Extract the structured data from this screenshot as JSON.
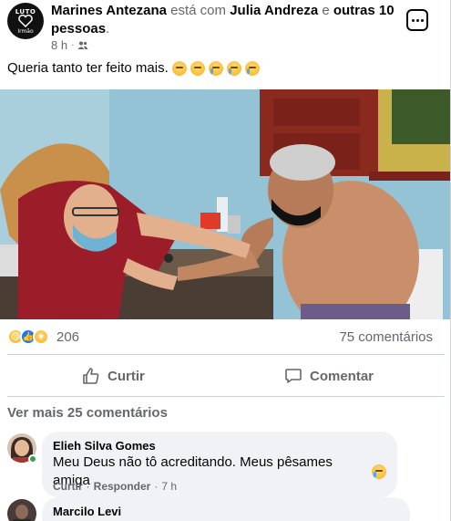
{
  "post": {
    "avatar": {
      "line1": "LUTO",
      "line2": "Irmão"
    },
    "author": "Marines Antezana",
    "with_text": "está com",
    "tagged": "Julia Andreza",
    "and_text": "e",
    "others": "outras 10 pessoas",
    "period": ".",
    "time": "8 h",
    "separator": "·",
    "audience_icon": "friends-icon",
    "text": "Queria tanto ter feito mais.",
    "emojis": [
      "sad",
      "sad",
      "crying",
      "crying",
      "crying"
    ]
  },
  "stats": {
    "reaction_icons": [
      "sad",
      "like",
      "care"
    ],
    "reaction_count": "206",
    "comments": "75 comentários"
  },
  "actions": {
    "like_label": "Curtir",
    "comment_label": "Comentar"
  },
  "comments_section": {
    "view_more": "Ver mais 25 comentários",
    "items": [
      {
        "author": "Elieh Silva Gomes",
        "text": "Meu Deus não tô acreditando. Meus pêsames amiga",
        "like": "Curtir",
        "reply": "Responder",
        "sep": "·",
        "time": "7 h"
      },
      {
        "author": "Marcilo Levi"
      }
    ]
  },
  "colors": {
    "accent": "#1877f2",
    "muted": "#65676b",
    "bubble": "#f0f2f5",
    "online": "#31a24c"
  }
}
